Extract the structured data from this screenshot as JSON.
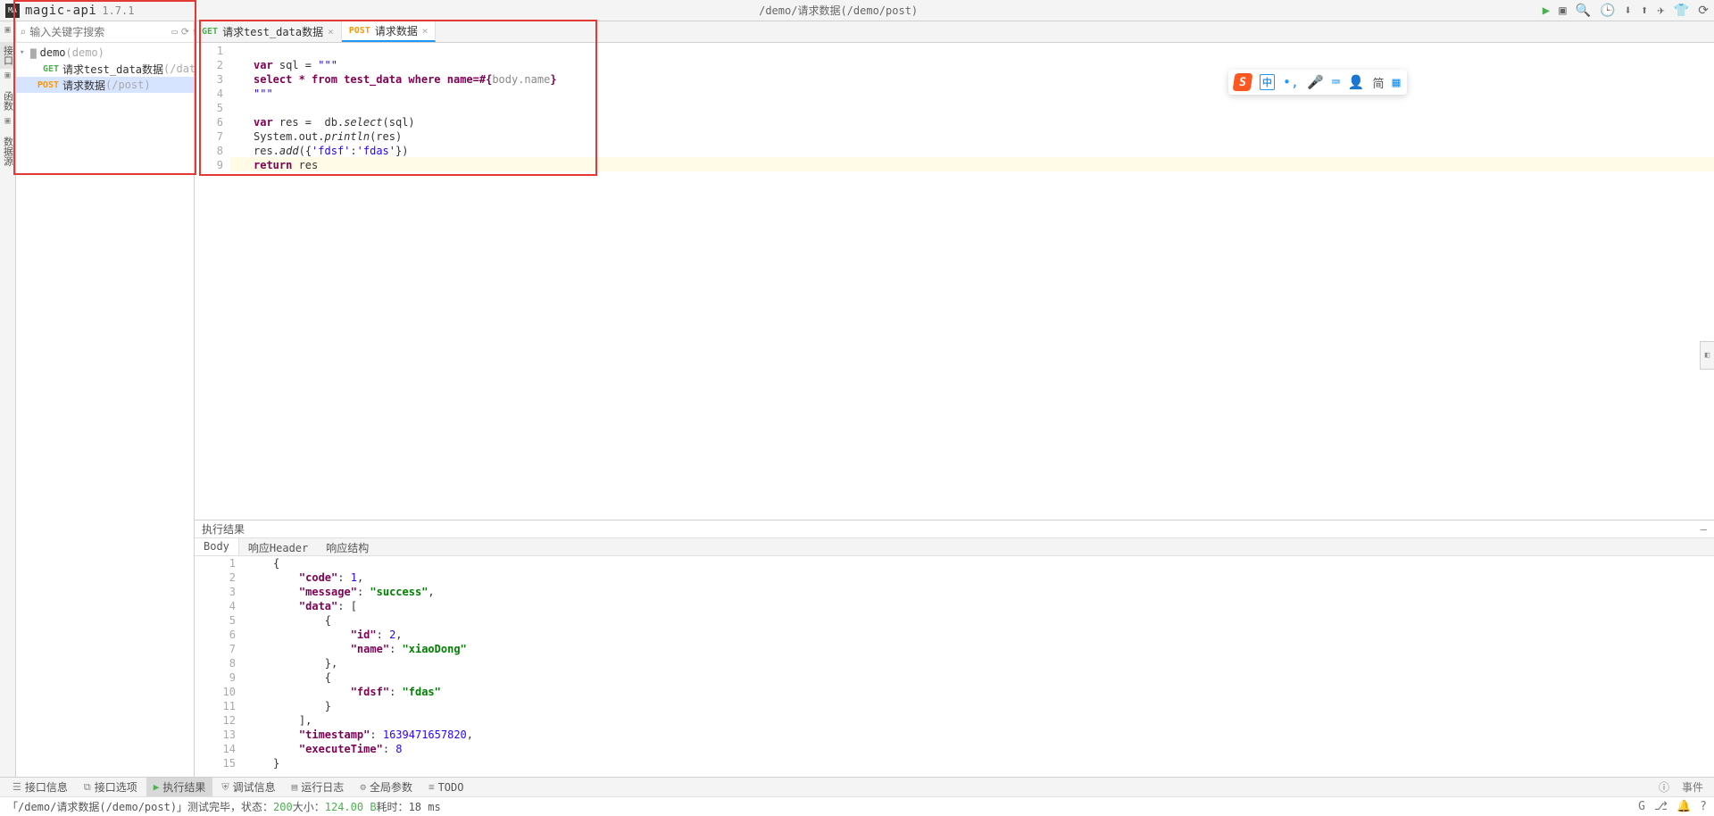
{
  "header": {
    "logo": "MA",
    "title": "magic-api",
    "version": "1.7.1",
    "breadcrumb": "/demo/请求数据(/demo/post)",
    "icons": [
      "run",
      "debug",
      "search",
      "history",
      "cloud-down",
      "cloud-up",
      "send",
      "shirt",
      "refresh"
    ]
  },
  "search": {
    "placeholder": "输入关键字搜索"
  },
  "rail": {
    "items": [
      "接口",
      "函数",
      "数据源"
    ]
  },
  "tree": {
    "root": {
      "name": "demo",
      "path": "(demo)"
    },
    "children": [
      {
        "method": "GET",
        "name": "请求test_data数据",
        "path": "(/data)",
        "sel": false
      },
      {
        "method": "POST",
        "name": "请求数据",
        "path": "(/post)",
        "sel": true
      }
    ]
  },
  "tabs": [
    {
      "method": "GET",
      "label": "请求test_data数据",
      "active": false
    },
    {
      "method": "POST",
      "label": "请求数据",
      "active": true
    }
  ],
  "code": {
    "lines": [
      1,
      2,
      3,
      4,
      5,
      6,
      7,
      8,
      9
    ],
    "l1a": "var",
    "l1b": " sql = ",
    "l1c": "\"\"\"",
    "l2": "select * from test_data where name=#{",
    "l2b": "body.name",
    "l2c": "}",
    "l3": "\"\"\"",
    "l5a": "var",
    "l5b": " res =  db.",
    "l5c": "select",
    "l5d": "(sql)",
    "l6a": "System.out.",
    "l6b": "println",
    "l6c": "(res)",
    "l7a": "res.",
    "l7b": "add",
    "l7c": "({",
    "l7d": "'fdsf'",
    "l7e": ":",
    "l7f": "'fdas'",
    "l7g": "})",
    "l8a": "return",
    "l8b": " res"
  },
  "results": {
    "title": "执行结果",
    "subtabs": [
      "Body",
      "响应Header",
      "响应结构"
    ],
    "json_lines": [
      1,
      2,
      3,
      4,
      5,
      6,
      7,
      8,
      9,
      10,
      11,
      12,
      13,
      14,
      15
    ],
    "body": {
      "code": 1,
      "message": "success",
      "data": [
        {
          "id": 2,
          "name": "xiaoDong"
        },
        {
          "fdsf": "fdas"
        }
      ],
      "timestamp": 1639471657820,
      "executeTime": 8
    }
  },
  "bottom": {
    "tabs": [
      "接口信息",
      "接口选项",
      "执行结果",
      "调试信息",
      "运行日志",
      "全局参数",
      "TODO"
    ],
    "events": "事件"
  },
  "status": {
    "prefix": "「/demo/请求数据(/demo/post)」测试完毕，状态：",
    "code": "200",
    "size_label": " 大小：",
    "size": "124.00 B",
    "time_label": " 耗时：",
    "time": "18 ms"
  },
  "ime": {
    "logo": "S",
    "zhong": "中",
    "jian": "简"
  }
}
